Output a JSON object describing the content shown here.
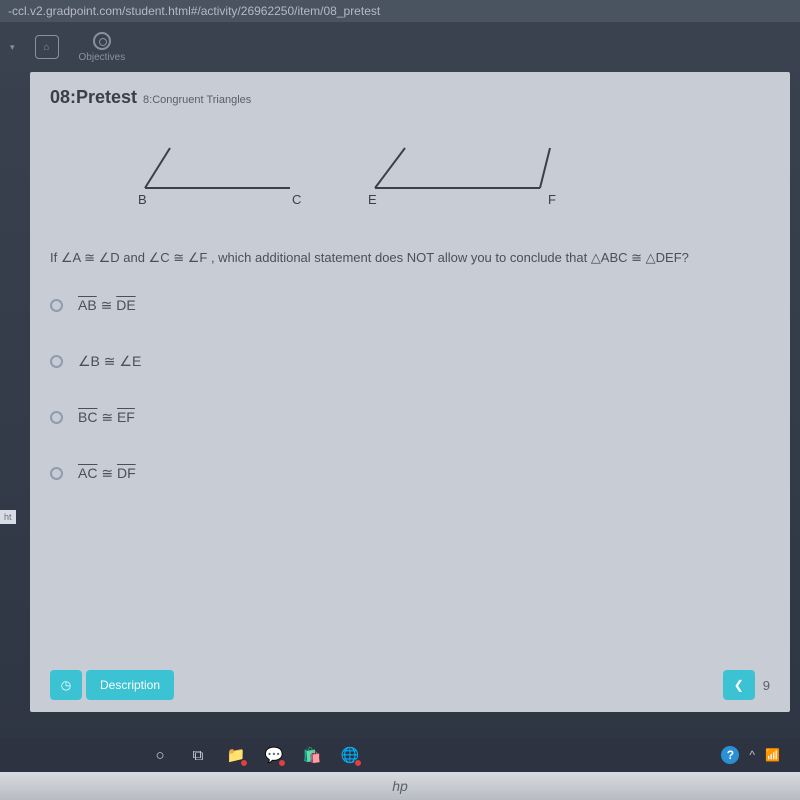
{
  "url": "-ccl.v2.gradpoint.com/student.html#/activity/26962250/item/08_pretest",
  "chrome": {
    "objectives_label": "Objectives"
  },
  "side_tab": "ht",
  "header": {
    "title": "08:Pretest",
    "subtitle": "8:Congruent Triangles"
  },
  "triangles": {
    "left": {
      "v1": "B",
      "v2": "C"
    },
    "right": {
      "v1": "E",
      "v2": "F"
    }
  },
  "question": {
    "prefix": "If ",
    "cond1_l": "∠A",
    "cong": " ≅ ",
    "cond1_r": "∠D",
    "and": "  and  ",
    "cond2_l": "∠C",
    "cond2_r": "∠F",
    "body": " , which additional statement does NOT allow you to conclude that ",
    "concl_l": "△ABC",
    "concl_r": "△DEF",
    "qmark": "?"
  },
  "options": [
    {
      "left": "AB",
      "right": "DE",
      "overline": true
    },
    {
      "left": "∠B",
      "right": "∠E",
      "overline": false
    },
    {
      "left": "BC",
      "right": "EF",
      "overline": true
    },
    {
      "left": "AC",
      "right": "DF",
      "overline": true
    }
  ],
  "footer": {
    "clock_icon": "◷",
    "description_label": "Description",
    "prev_icon": "❮",
    "page_num": "9"
  },
  "taskbar": {
    "cortana": "○",
    "taskview": "⧉",
    "help": "?",
    "caret": "^"
  },
  "laptop_brand": "hp"
}
